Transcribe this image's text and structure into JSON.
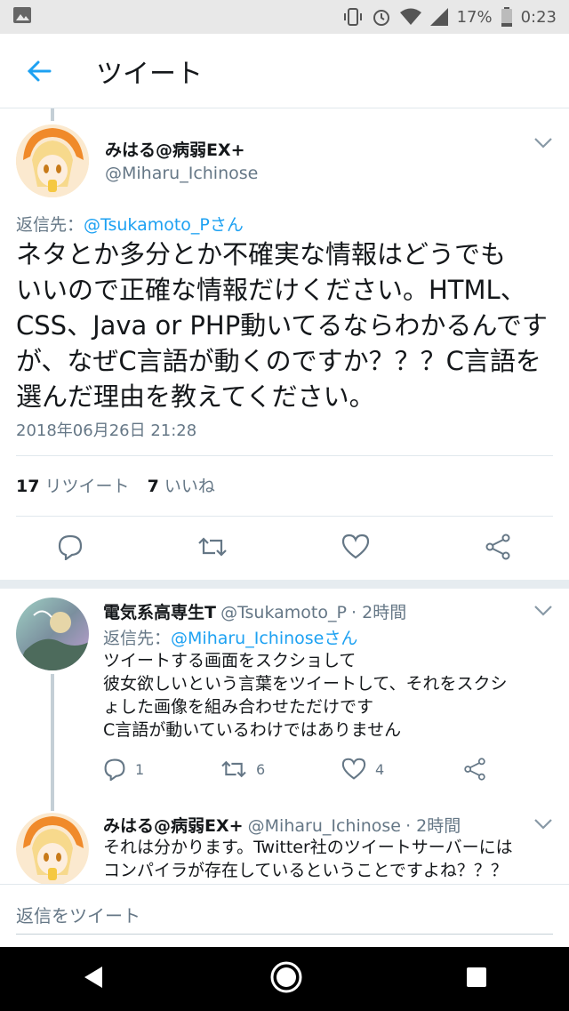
{
  "status_bar": {
    "battery": "17%",
    "time": "0:23"
  },
  "app_bar": {
    "title": "ツイート"
  },
  "main_tweet": {
    "display_name": "みはる@病弱EX+",
    "handle": "@Miharu_Ichinose",
    "reply_prefix": "返信先：",
    "reply_to": "@Tsukamoto_Pさん",
    "text_lines": [
      "ネタとか多分とか不確実な情報はどうでも",
      "いいので正確な情報だけください。HTML、",
      "CSS、Java or PHP動いてるならわかるんです",
      "が、なぜC言語が動くのですか？？？C言語を",
      "選んだ理由を教えてください。"
    ],
    "timestamp": "2018年06月26日 21:28",
    "retweet_count": "17",
    "retweet_label": "リツイート",
    "like_count": "7",
    "like_label": "いいね"
  },
  "replies": [
    {
      "display_name": "電気系高専生T",
      "handle": "@Tsukamoto_P",
      "time": "· 2時間",
      "reply_prefix": "返信先：",
      "reply_to": "@Miharu_Ichinoseさん",
      "text_lines": [
        "ツイートする画面をスクショして",
        "彼女欲しいという言葉をツイートして、それをスクシ",
        "ょした画像を組み合わせただけです",
        "C言語が動いているわけではありません"
      ],
      "reply_count": "1",
      "retweet_count": "6",
      "like_count": "4"
    },
    {
      "display_name": "みはる@病弱EX+",
      "handle": "@Miharu_Ichinose",
      "time": "· 2時間",
      "text_lines": [
        "それは分かります。Twitter社のツイートサーバーには",
        "コンパイラが存在しているということですよね？？？"
      ]
    }
  ],
  "compose": {
    "placeholder": "返信をツイート"
  },
  "colors": {
    "accent": "#1da1f2",
    "secondary_text": "#657786",
    "divider": "#e1e8ed"
  }
}
